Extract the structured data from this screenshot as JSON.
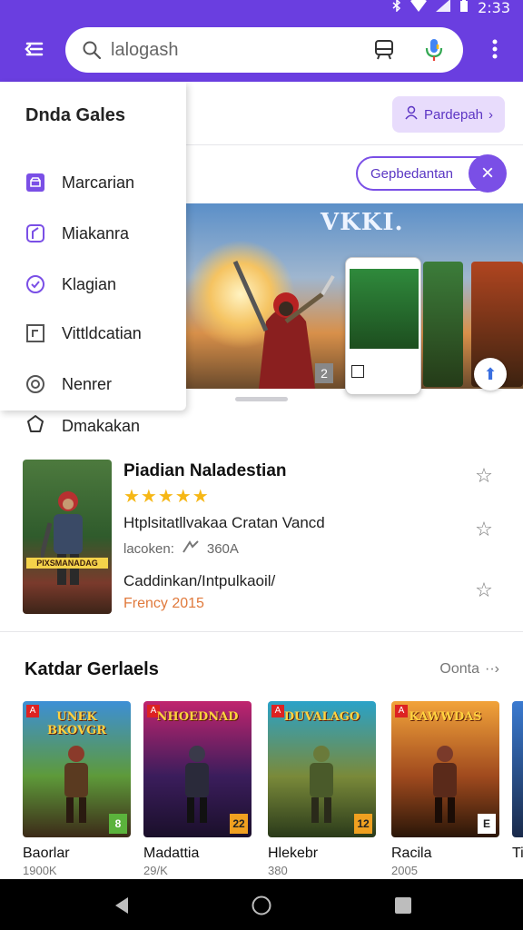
{
  "status": {
    "time": "2:33"
  },
  "search": {
    "query": "lalogash"
  },
  "header": {
    "profile_button": "Pardepah"
  },
  "filter_chip": {
    "label": "Gepbedantan"
  },
  "banner": {
    "title": "VKKI.",
    "badge": "2"
  },
  "drawer": {
    "title": "Dnda Gales",
    "items": [
      {
        "label": "Marcarian",
        "icon": "store-icon"
      },
      {
        "label": "Miakanra",
        "icon": "bookmark-icon"
      },
      {
        "label": "Klagian",
        "icon": "check-circle-icon"
      },
      {
        "label": "Vittldcatian",
        "icon": "square-icon"
      },
      {
        "label": "Nenrer",
        "icon": "gear-icon"
      }
    ],
    "outside_item": {
      "label": "Dmakakan",
      "icon": "tag-icon"
    }
  },
  "featured": {
    "name": "Piadian Naladestian",
    "rating": "★★★★★",
    "description": "Htplsitatllvakaa Cratan Vancd",
    "meta_left": "lacoken:",
    "meta_size": "360A",
    "publisher": "Caddinkan/Intpulkaoil/",
    "date": "Frency 2015",
    "cover_caption": "PIXSMANADAG"
  },
  "section": {
    "title": "Katdar Gerlaels",
    "more": "Oonta"
  },
  "games": [
    {
      "name": "Baorlar",
      "size": "1900K",
      "cover_title": "UNEK BKOVGR",
      "rating_badge": "8",
      "colors": [
        "#3d8fd6",
        "#5e9a3a",
        "#3c2a18"
      ]
    },
    {
      "name": "Madattia",
      "size": "29/K",
      "cover_title": "NHOEDNAD",
      "rating_badge": "22",
      "colors": [
        "#c0246e",
        "#3b1d5c",
        "#1a0f2a"
      ]
    },
    {
      "name": "Hlekebr",
      "size": "380",
      "cover_title": "DUVALAGO",
      "rating_badge": "12",
      "colors": [
        "#2aa2c8",
        "#7a8a3a",
        "#2a3a1a"
      ]
    },
    {
      "name": "Racila",
      "size": "2005",
      "cover_title": "KAWWDAS",
      "rating_badge": "E",
      "colors": [
        "#f2a33a",
        "#a04a1e",
        "#2a1608"
      ]
    }
  ],
  "partial_game": {
    "name": "Ti"
  }
}
